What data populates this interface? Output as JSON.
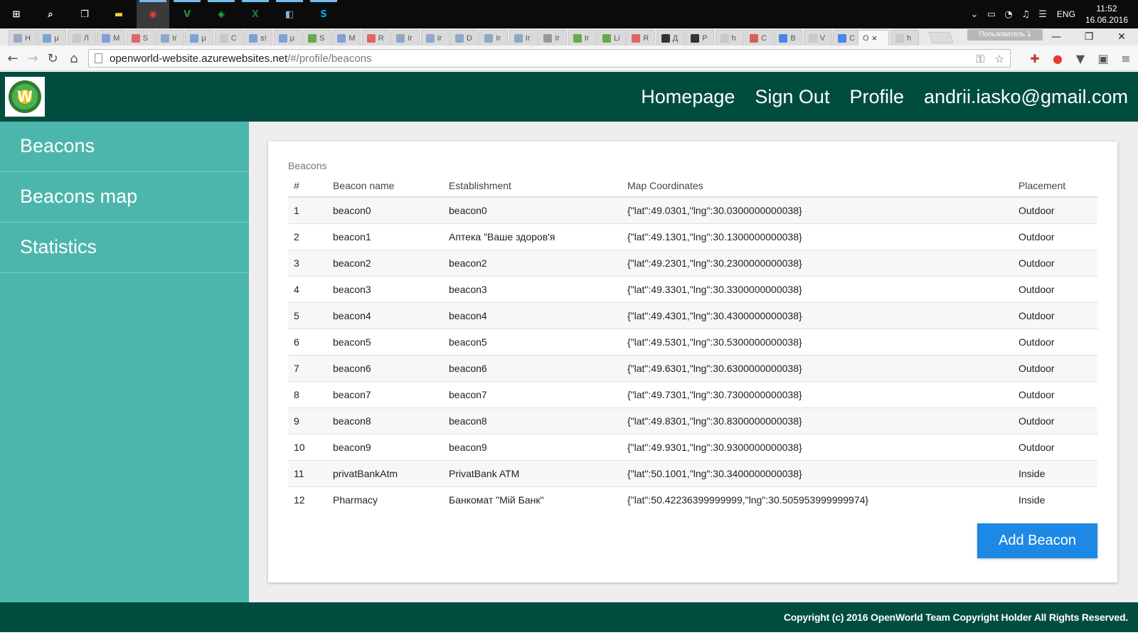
{
  "taskbar": {
    "apps": [
      {
        "icon": "windows-start-icon",
        "color": "#ffffff",
        "glyph": "⊞"
      },
      {
        "icon": "search-icon",
        "color": "#ffffff",
        "glyph": "⌕"
      },
      {
        "icon": "task-view-icon",
        "color": "#ffffff",
        "glyph": "❐"
      },
      {
        "icon": "file-explorer-icon",
        "color": "#f9c93b",
        "glyph": "▬"
      },
      {
        "icon": "chrome-icon",
        "color": "#db4437",
        "glyph": "◉"
      },
      {
        "icon": "vim-icon",
        "color": "#1f8f3a",
        "glyph": "V"
      },
      {
        "icon": "network-app-icon",
        "color": "#1fb44a",
        "glyph": "◈"
      },
      {
        "icon": "excel-icon",
        "color": "#1f7246",
        "glyph": "X"
      },
      {
        "icon": "blue-app-icon",
        "color": "#7fb3de",
        "glyph": "◧"
      },
      {
        "icon": "skype-icon",
        "color": "#00aff0",
        "glyph": "S"
      }
    ],
    "tray": {
      "icons": [
        "chevron-up-icon",
        "battery-icon",
        "wifi-icon",
        "volume-icon",
        "notifications-icon"
      ],
      "lang": "ENG",
      "time": "11:52",
      "date": "16.06.2016"
    }
  },
  "browser": {
    "tabs": [
      {
        "label": "H",
        "color": "#9aa9c7"
      },
      {
        "label": "μ",
        "color": "#7fa2d6"
      },
      {
        "label": "Л",
        "color": "#c9c9c9"
      },
      {
        "label": "M",
        "color": "#7fa2d6"
      },
      {
        "label": "S",
        "color": "#e06666"
      },
      {
        "label": "Ir",
        "color": "#8fa8c9"
      },
      {
        "label": "μ",
        "color": "#7fa2d6"
      },
      {
        "label": "C",
        "color": "#c9c9c9"
      },
      {
        "label": "s!",
        "color": "#7fa2d6"
      },
      {
        "label": "μ",
        "color": "#7fa2d6"
      },
      {
        "label": "S",
        "color": "#6aa84f"
      },
      {
        "label": "M",
        "color": "#7fa2d6"
      },
      {
        "label": "R",
        "color": "#e06666"
      },
      {
        "label": "Ir",
        "color": "#8fa8c9"
      },
      {
        "label": "Ir",
        "color": "#8fa8c9"
      },
      {
        "label": "D",
        "color": "#8fa8c9"
      },
      {
        "label": "Ir",
        "color": "#8fa8c9"
      },
      {
        "label": "Ir",
        "color": "#8fa8c9"
      },
      {
        "label": "Ir",
        "color": "#999999"
      },
      {
        "label": "Ir",
        "color": "#6aa84f"
      },
      {
        "label": "Li",
        "color": "#6aa84f"
      },
      {
        "label": "R",
        "color": "#e06666"
      },
      {
        "label": "Д",
        "color": "#333333"
      },
      {
        "label": "P",
        "color": "#333333"
      },
      {
        "label": "h",
        "color": "#c9c9c9"
      },
      {
        "label": "C",
        "color": "#d65f5f"
      },
      {
        "label": "B",
        "color": "#4a86e8"
      },
      {
        "label": "V",
        "color": "#c9c9c9"
      },
      {
        "label": "C",
        "color": "#4a86e8"
      }
    ],
    "active_tab": {
      "label": "O",
      "close": "×"
    },
    "last_tab": {
      "label": "h",
      "color": "#c9c9c9"
    },
    "user_badge": "Пользователь 1",
    "window_controls": {
      "minimize": "—",
      "maximize": "❐",
      "close": "✕"
    },
    "nav": {
      "back": "←",
      "forward": "→",
      "reload": "↻",
      "home": "⌂"
    },
    "url": {
      "host": "openworld-website.azurewebsites.net",
      "path": "/#/profile/beacons"
    },
    "omnibox_icons": {
      "key": "⚿",
      "star": "☆"
    },
    "extensions": [
      {
        "icon": "puzzle-extension-icon",
        "glyph": "✚",
        "color": "#c0392b"
      },
      {
        "icon": "opera-extension-icon",
        "glyph": "●",
        "color": "#e53935"
      },
      {
        "icon": "pocket-icon",
        "glyph": "▼",
        "color": "#555555"
      },
      {
        "icon": "translate-icon",
        "glyph": "▣",
        "color": "#555555"
      },
      {
        "icon": "menu-icon",
        "glyph": "≡",
        "color": "#555555"
      }
    ]
  },
  "site": {
    "logo_letter": "W",
    "nav": [
      "Homepage",
      "Sign Out",
      "Profile",
      "andrii.iasko@gmail.com"
    ],
    "sidebar": [
      "Beacons",
      "Beacons map",
      "Statistics"
    ],
    "table": {
      "caption": "Beacons",
      "headers": [
        "#",
        "Beacon name",
        "Establishment",
        "Map Coordinates",
        "Placement"
      ],
      "rows": [
        [
          "1",
          "beacon0",
          "beacon0",
          "{\"lat\":49.0301,\"lng\":30.0300000000038}",
          "Outdoor"
        ],
        [
          "2",
          "beacon1",
          "Аптека \"Ваше здоров'я",
          "{\"lat\":49.1301,\"lng\":30.1300000000038}",
          "Outdoor"
        ],
        [
          "3",
          "beacon2",
          "beacon2",
          "{\"lat\":49.2301,\"lng\":30.2300000000038}",
          "Outdoor"
        ],
        [
          "4",
          "beacon3",
          "beacon3",
          "{\"lat\":49.3301,\"lng\":30.3300000000038}",
          "Outdoor"
        ],
        [
          "5",
          "beacon4",
          "beacon4",
          "{\"lat\":49.4301,\"lng\":30.4300000000038}",
          "Outdoor"
        ],
        [
          "6",
          "beacon5",
          "beacon5",
          "{\"lat\":49.5301,\"lng\":30.5300000000038}",
          "Outdoor"
        ],
        [
          "7",
          "beacon6",
          "beacon6",
          "{\"lat\":49.6301,\"lng\":30.6300000000038}",
          "Outdoor"
        ],
        [
          "8",
          "beacon7",
          "beacon7",
          "{\"lat\":49.7301,\"lng\":30.7300000000038}",
          "Outdoor"
        ],
        [
          "9",
          "beacon8",
          "beacon8",
          "{\"lat\":49.8301,\"lng\":30.8300000000038}",
          "Outdoor"
        ],
        [
          "10",
          "beacon9",
          "beacon9",
          "{\"lat\":49.9301,\"lng\":30.9300000000038}",
          "Outdoor"
        ],
        [
          "11",
          "privatBankAtm",
          "PrivatBank ATM",
          "{\"lat\":50.1001,\"lng\":30.3400000000038}",
          "Inside"
        ],
        [
          "12",
          "Pharmacy",
          "Банкомат \"Мій Банк\"",
          "{\"lat\":50.42236399999999,\"lng\":30.505953999999974}",
          "Inside"
        ]
      ]
    },
    "add_button": "Add Beacon",
    "footer": "Copyright (c) 2016 OpenWorld Team Copyright Holder All Rights Reserved."
  },
  "colors": {
    "header_bg": "#004d40",
    "sidebar_bg": "#4db6ac",
    "button_bg": "#1e88e5"
  }
}
